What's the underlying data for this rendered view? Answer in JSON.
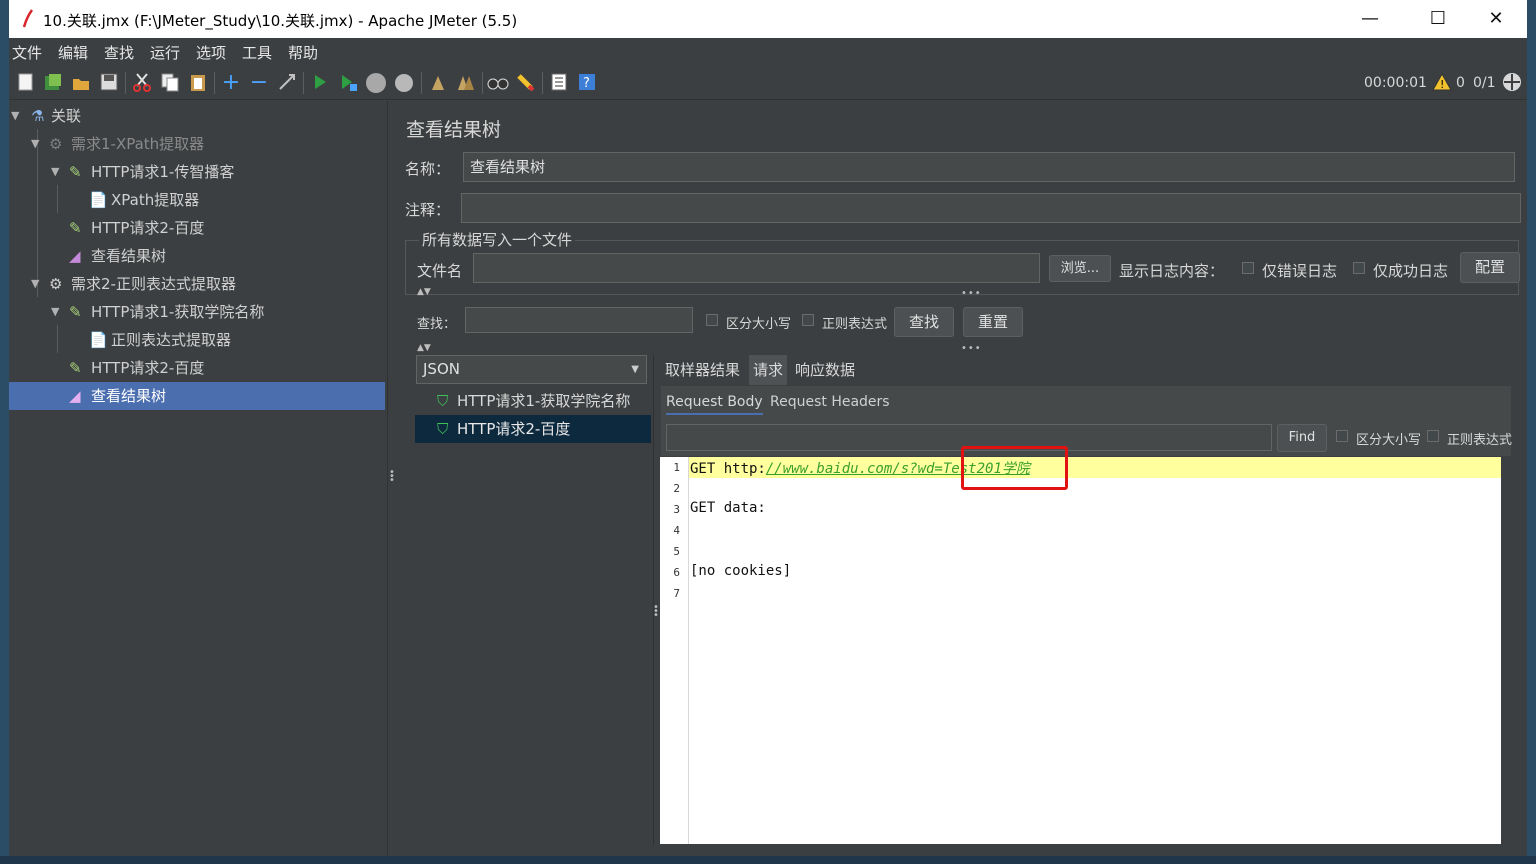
{
  "window": {
    "title": "10.关联.jmx (F:\\JMeter_Study\\10.关联.jmx) - Apache JMeter (5.5)",
    "minimize": "—",
    "maximize": "☐",
    "close": "✕"
  },
  "menu": [
    "文件",
    "编辑",
    "查找",
    "运行",
    "选项",
    "工具",
    "帮助"
  ],
  "status": {
    "timer": "00:00:01",
    "warnings": "0",
    "threads": "0/1"
  },
  "tree": {
    "root": "关联",
    "group1": "需求1-XPath提取器",
    "g1_req1": "HTTP请求1-传智播客",
    "g1_xpath": "XPath提取器",
    "g1_req2": "HTTP请求2-百度",
    "g1_view": "查看结果树",
    "group2": "需求2-正则表达式提取器",
    "g2_req1": "HTTP请求1-获取学院名称",
    "g2_regex": "正则表达式提取器",
    "g2_req2": "HTTP请求2-百度",
    "g2_view": "查看结果树"
  },
  "panel": {
    "heading": "查看结果树",
    "name_label": "名称：",
    "name_value": "查看结果树",
    "comment_label": "注释：",
    "file_section": "所有数据写入一个文件",
    "filename_label": "文件名",
    "browse": "浏览...",
    "log_label": "显示日志内容：",
    "errors_only": "仅错误日志",
    "success_only": "仅成功日志",
    "config": "配置",
    "search_label": "查找：",
    "case_sensitive": "区分大小写",
    "regex": "正则表达式",
    "find_btn": "查找",
    "reset_btn": "重置",
    "renderer": "JSON"
  },
  "results": [
    {
      "label": "HTTP请求1-获取学院名称"
    },
    {
      "label": "HTTP请求2-百度"
    }
  ],
  "tabs": [
    "取样器结果",
    "请求",
    "响应数据"
  ],
  "subtabs": [
    "Request Body",
    "Request Headers"
  ],
  "find": {
    "button": "Find",
    "case_sensitive": "区分大小写",
    "regex": "正则表达式"
  },
  "code": {
    "line_numbers": [
      "1",
      "2",
      "3",
      "4",
      "5",
      "6",
      "7"
    ],
    "line1_prefix": "GET http:",
    "line1_link": "//www.baidu.com/s?wd=",
    "line1_param": "Test201学院",
    "line3": "GET data:",
    "line6": "[no cookies]"
  },
  "colors": {
    "selection": "#4b6eaf",
    "highlight": "#ffff9e",
    "annotation": "#e31212"
  }
}
